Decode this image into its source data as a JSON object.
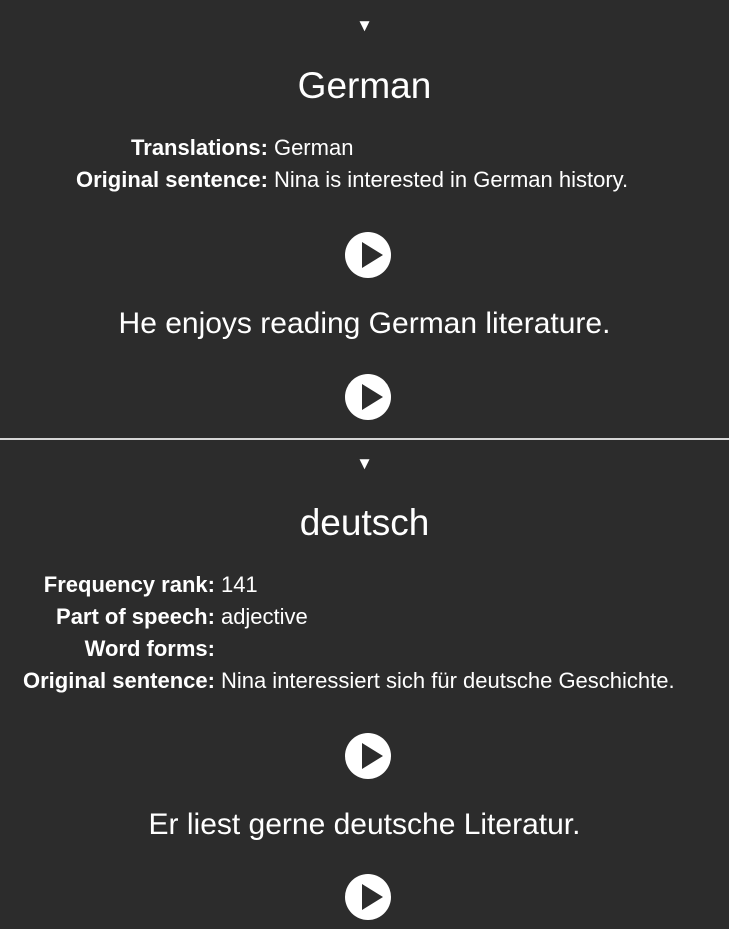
{
  "front": {
    "toggle_glyph": "▼",
    "word": "German",
    "fields": [
      {
        "label": "Translations:",
        "value": "German"
      },
      {
        "label": "Original sentence:",
        "value": "Nina is interested in German history."
      }
    ],
    "example_sentence": "He enjoys reading German literature."
  },
  "back": {
    "toggle_glyph": "▼",
    "word": "deutsch",
    "fields": [
      {
        "label": "Frequency rank:",
        "value": "141"
      },
      {
        "label": "Part of speech:",
        "value": "adjective"
      },
      {
        "label": "Word forms:",
        "value": ""
      },
      {
        "label": "Original sentence:",
        "value": "Nina interessiert sich für deutsche Geschichte."
      }
    ],
    "example_sentence": "Er liest gerne deutsche Literatur."
  },
  "icons": {
    "play": "play-icon",
    "toggle": "collapse-triangle-icon"
  },
  "colors": {
    "background": "#2c2c2c",
    "text": "#ffffff",
    "divider": "#d6d6d6"
  }
}
